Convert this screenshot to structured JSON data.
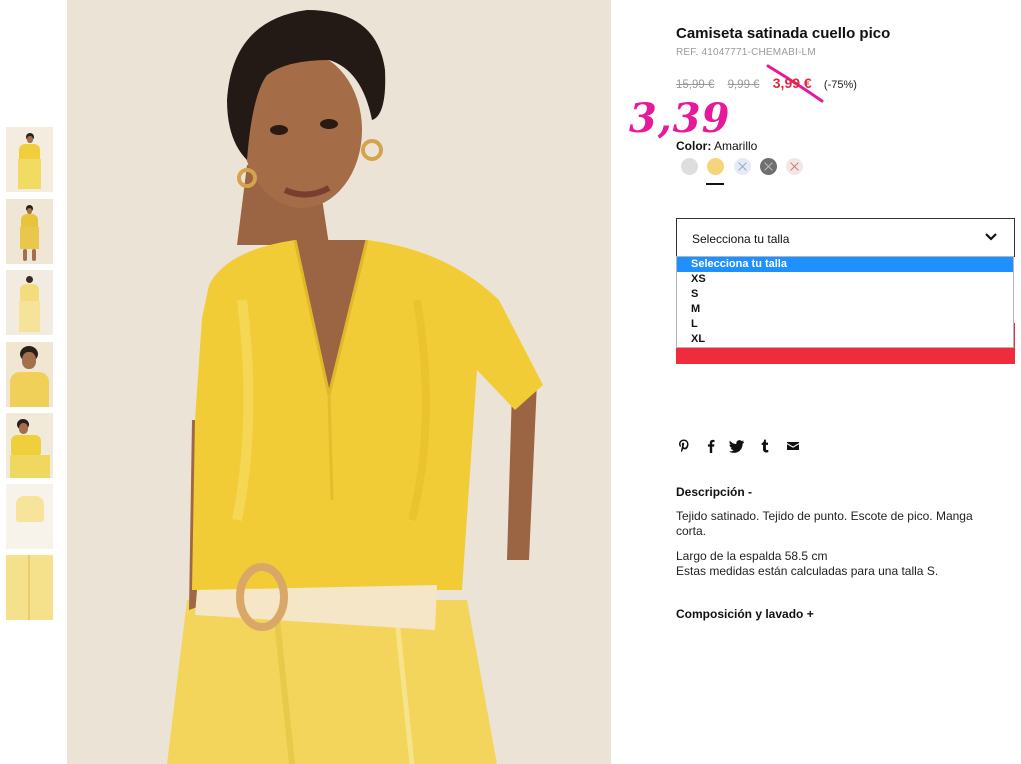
{
  "product": {
    "title": "Camiseta satinada cuello pico",
    "ref": "REF. 41047771-CHEMABI-LM",
    "prices": {
      "original": "15,99 €",
      "previous": "9,99 €",
      "sale": "3,99 €",
      "discount": "(-75%)"
    },
    "handwritten_price": "3,39",
    "color_label": "Color:",
    "color_value": "Amarillo",
    "swatches": [
      {
        "name": "gris",
        "color": "#e0e0e0",
        "available": true
      },
      {
        "name": "amarillo",
        "color": "#f6d57a",
        "available": true,
        "selected": true
      },
      {
        "name": "azul",
        "color": "#e7ebf6",
        "available": false
      },
      {
        "name": "gris-oscuro",
        "color": "#6f6f6f",
        "available": false
      },
      {
        "name": "rosa",
        "color": "#f3e6e6",
        "available": false
      }
    ]
  },
  "size_select": {
    "label": "Selecciona tu talla",
    "options": [
      "Selecciona tu talla",
      "XS",
      "S",
      "M",
      "L",
      "XL"
    ],
    "selected": "Selecciona tu talla"
  },
  "share_icons": [
    "pinterest-icon",
    "facebook-icon",
    "twitter-icon",
    "tumblr-icon",
    "email-icon"
  ],
  "description": {
    "heading": "Descripción -",
    "text1": "Tejido satinado. Tejido de punto. Escote de pico. Manga corta.",
    "text2a": "Largo de la espalda 58.5 cm",
    "text2b": "Estas medidas están calculadas para una talla S."
  },
  "composition": {
    "heading": "Composición y lavado +"
  },
  "colors": {
    "sale_red": "#e0283a",
    "button_red": "#ee2c3c",
    "handwriting_pink": "#e6199b",
    "select_blue": "#1e90ff",
    "garment_yellow": "#f0cf3c"
  }
}
